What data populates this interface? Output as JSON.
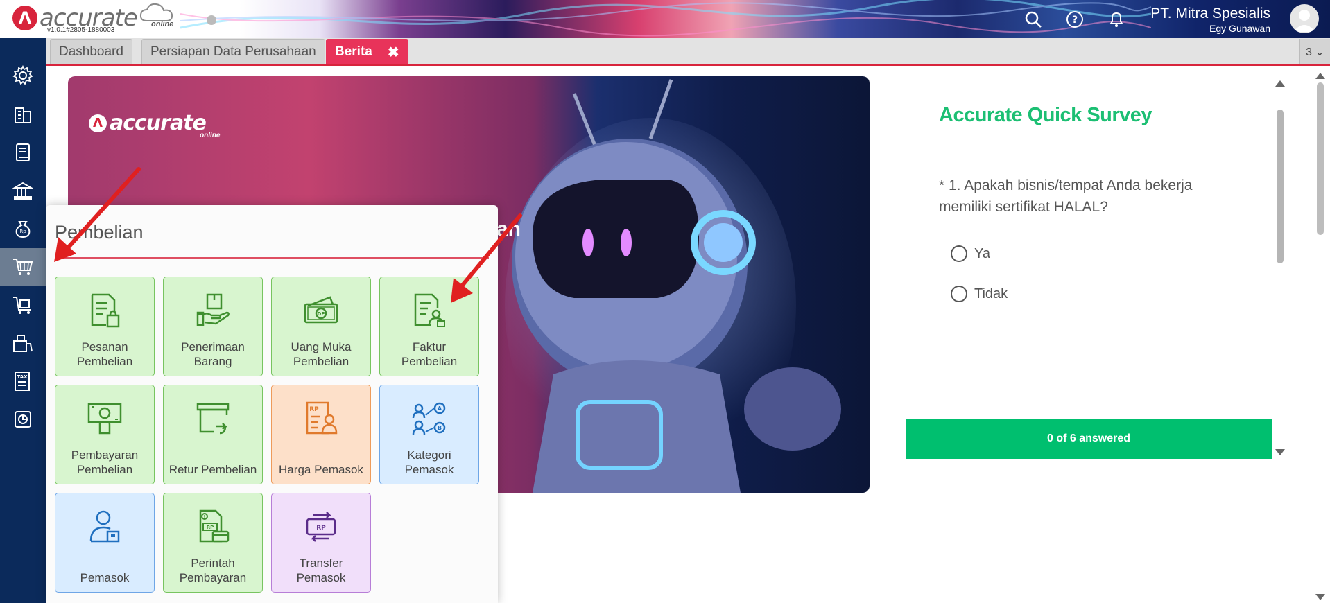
{
  "app": {
    "logo_text": "accurate",
    "logo_sub": "online",
    "version": "v1.0.1#2805-1880003",
    "company_name": "PT. Mitra Spesialis",
    "user_name": "Egy Gunawan"
  },
  "tabs": [
    {
      "label": "Dashboard",
      "active": false
    },
    {
      "label": "Persiapan Data Perusahaan",
      "active": false
    },
    {
      "label": "Berita",
      "active": true,
      "close": "✖"
    }
  ],
  "tab_count": "3 ⌄",
  "banner": {
    "logo_text": "accurate",
    "logo_sub": "online",
    "partial_text": "an"
  },
  "survey": {
    "title": "Accurate Quick Survey",
    "question": "* 1. Apakah bisnis/tempat Anda bekerja memiliki sertifikat HALAL?",
    "options": [
      "Ya",
      "Tidak"
    ],
    "progress": "0 of 6 answered",
    "answered": 0,
    "total": 6
  },
  "popup": {
    "title": "Pembelian",
    "tiles": [
      {
        "label": "Pesanan\nPembelian",
        "icon": "purchase-order-icon",
        "color": "green"
      },
      {
        "label": "Penerimaan\nBarang",
        "icon": "receive-goods-icon",
        "color": "green"
      },
      {
        "label": "Uang Muka\nPembelian",
        "icon": "down-payment-icon",
        "color": "green"
      },
      {
        "label": "Faktur\nPembelian",
        "icon": "purchase-invoice-icon",
        "color": "green"
      },
      {
        "label": "Pembayaran\nPembelian",
        "icon": "payment-icon",
        "color": "green"
      },
      {
        "label": "Retur Pembelian",
        "icon": "return-icon",
        "color": "green"
      },
      {
        "label": "Harga Pemasok",
        "icon": "supplier-price-icon",
        "color": "orange"
      },
      {
        "label": "Kategori\nPemasok",
        "icon": "supplier-category-icon",
        "color": "blue"
      },
      {
        "label": "Pemasok",
        "icon": "supplier-icon",
        "color": "blue"
      },
      {
        "label": "Perintah\nPembayaran",
        "icon": "payment-order-icon",
        "color": "green"
      },
      {
        "label": "Transfer\nPemasok",
        "icon": "supplier-transfer-icon",
        "color": "purple"
      }
    ]
  },
  "nav": [
    "settings-icon",
    "company-icon",
    "ledger-icon",
    "bank-icon",
    "cash-icon",
    "purchase-cart-icon",
    "sales-cart-icon",
    "inventory-icon",
    "tax-icon",
    "report-icon"
  ],
  "colors": {
    "accent": "#d8243c",
    "nav_bg": "#0b2a5b",
    "survey_green": "#1cbf73",
    "tab_active": "#e8335a",
    "arrow_red": "#e02020"
  }
}
